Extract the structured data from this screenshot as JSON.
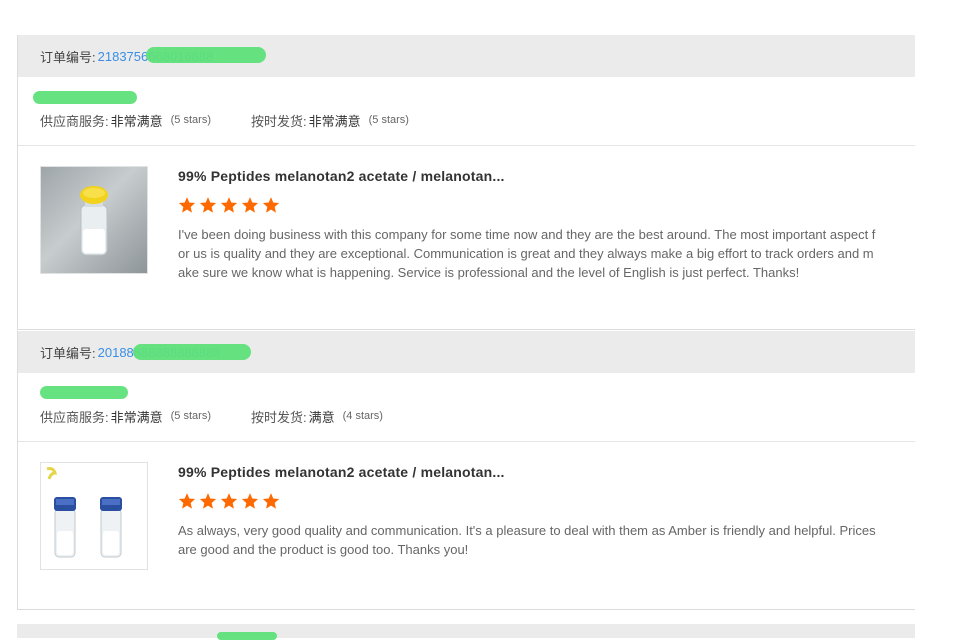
{
  "reviews": [
    {
      "order_label": "订单编号:",
      "order_number": "2183756668016888",
      "supplier_service_label": "供应商服务:",
      "supplier_service_value": "非常满意",
      "supplier_service_stars": "(5 stars)",
      "delivery_label": "按时发货:",
      "delivery_value": "非常满意",
      "delivery_stars": "(5 stars)",
      "product_title": "99% Peptides melanotan2 acetate / melanotan...",
      "rating": 5,
      "review_text": "I've been doing business with this company for some time now and they are the best around. The most important aspect for us is quality and they are exceptional. Communication is great and they always make a big effort to track orders and make sure we know what is happening. Service is professional and the level of English is just perfect. Thanks!"
    },
    {
      "order_label": "订单编号:",
      "order_number": "20188888888888888",
      "supplier_service_label": "供应商服务:",
      "supplier_service_value": "非常满意",
      "supplier_service_stars": "(5 stars)",
      "delivery_label": "按时发货:",
      "delivery_value": "满意",
      "delivery_stars": "(4 stars)",
      "product_title": "99% Peptides melanotan2 acetate / melanotan...",
      "rating": 5,
      "review_text": "As always, very good quality and communication. It's a pleasure to deal with them as Amber is friendly and helpful. Prices are good and the product is good too. Thanks you!"
    }
  ],
  "colors": {
    "star": "#ff6a00",
    "order_number": "#3a8ee6",
    "redaction": "#5ee07a",
    "header_bg": "#ebebeb"
  },
  "icons": [
    "star-icon",
    "vial-yellow-cap-image",
    "vials-blue-cap-image"
  ]
}
